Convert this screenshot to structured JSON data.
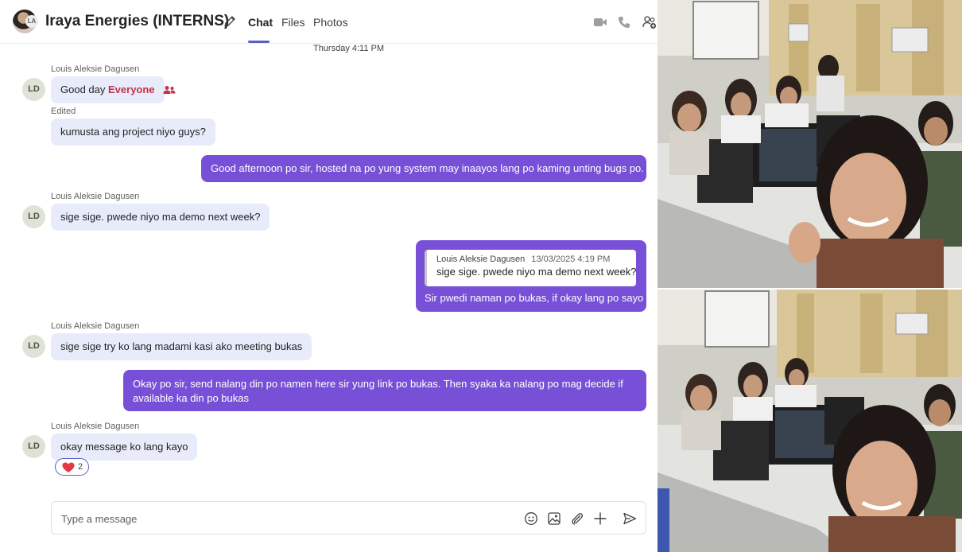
{
  "header": {
    "group_badge": "LA",
    "title": "Iraya Energies (INTERNS)",
    "tabs": [
      {
        "label": "Chat",
        "active": true
      },
      {
        "label": "Files",
        "active": false
      },
      {
        "label": "Photos",
        "active": false
      }
    ],
    "icons": [
      "video-call-icon",
      "audio-call-icon",
      "add-people-icon"
    ]
  },
  "chat": {
    "timestamp": "Thursday 4:11 PM",
    "messages": [
      {
        "sender": "Louis Aleksie Dagusen",
        "avatar": "LD",
        "text_pre": "Good day ",
        "mention": "Everyone"
      },
      {
        "edited": "Edited",
        "text": "kumusta ang project niyo guys?"
      },
      {
        "outgoing": true,
        "text": "Good afternoon po sir, hosted na po yung system may inaayos lang po kaming unting bugs po."
      },
      {
        "sender": "Louis Aleksie Dagusen",
        "avatar": "LD",
        "text": "sige sige. pwede niyo ma demo next week?"
      },
      {
        "outgoing": true,
        "quote": {
          "sender": "Louis Aleksie Dagusen",
          "time": "13/03/2025 4:19 PM",
          "text": "sige sige. pwede niyo ma demo next week?"
        },
        "text": "Sir pwedi naman po bukas, if okay lang po sayo"
      },
      {
        "sender": "Louis Aleksie Dagusen",
        "avatar": "LD",
        "text": "sige sige try ko lang madami kasi ako meeting bukas"
      },
      {
        "outgoing": true,
        "text_line1": "Okay po sir, send nalang din po namen here sir yung link po bukas. Then syaka ka nalang po mag decide if",
        "text_line2": "available ka din po bukas"
      },
      {
        "sender": "Louis Aleksie Dagusen",
        "avatar": "LD",
        "text": "okay message ko lang kayo",
        "reaction": {
          "emoji": "heart",
          "count": "2"
        }
      }
    ]
  },
  "composer": {
    "placeholder": "Type a message",
    "icons": [
      "emoji-icon",
      "image-icon",
      "attach-icon",
      "plus-icon",
      "send-icon"
    ]
  },
  "colors": {
    "accent": "#5b5fc7",
    "outgoing_bubble": "#7850d8",
    "incoming_bubble": "#e8ebfa",
    "mention": "#c4314b"
  }
}
